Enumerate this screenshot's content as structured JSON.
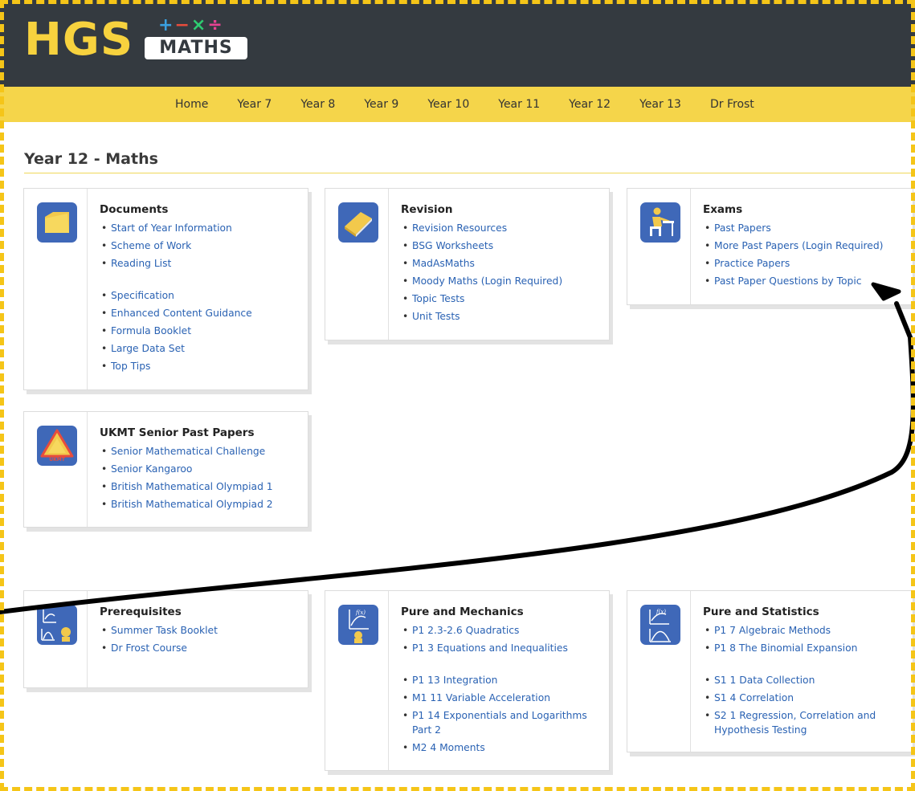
{
  "logo": {
    "main": "HGS",
    "sub": "MATHS",
    "operators": [
      "+",
      "−",
      "×",
      "÷"
    ]
  },
  "nav": [
    "Home",
    "Year 7",
    "Year 8",
    "Year 9",
    "Year 10",
    "Year 11",
    "Year 12",
    "Year 13",
    "Dr Frost"
  ],
  "page_title": "Year 12 - Maths",
  "cards": {
    "documents": {
      "title": "Documents",
      "links": [
        "Start of Year Information",
        "Scheme of Work",
        "Reading List"
      ],
      "links2": [
        "Specification",
        "Enhanced Content Guidance",
        "Formula Booklet",
        "Large Data Set",
        "Top Tips"
      ]
    },
    "revision": {
      "title": "Revision",
      "links": [
        "Revision Resources",
        "BSG Worksheets",
        "MadAsMaths",
        "Moody Maths (Login Required)",
        "Topic Tests",
        "Unit Tests"
      ]
    },
    "exams": {
      "title": "Exams",
      "links": [
        "Past Papers",
        "More Past Papers (Login Required)",
        "Practice Papers",
        "Past Paper Questions by Topic"
      ]
    },
    "ukmt": {
      "title": "UKMT Senior Past Papers",
      "icon_text": "UKMT",
      "links": [
        "Senior Mathematical Challenge",
        "Senior Kangaroo",
        "British Mathematical Olympiad 1",
        "British Mathematical Olympiad 2"
      ]
    },
    "prerequisites": {
      "title": "Prerequisites",
      "links": [
        "Summer Task Booklet",
        "Dr Frost Course"
      ]
    },
    "pure_mechanics": {
      "title": "Pure and Mechanics",
      "links": [
        "P1 2.3-2.6 Quadratics",
        "P1 3 Equations and Inequalities"
      ],
      "links2": [
        "P1 13 Integration",
        "M1 11 Variable Acceleration",
        "P1 14 Exponentials and Logarithms Part 2",
        "M2 4 Moments"
      ]
    },
    "pure_statistics": {
      "title": "Pure and Statistics",
      "links": [
        "P1 7 Algebraic Methods",
        "P1 8 The Binomial Expansion"
      ],
      "links2": [
        "S1 1 Data Collection",
        "S1 4 Correlation",
        "S2 1 Regression, Correlation and Hypothesis Testing"
      ]
    }
  },
  "colors": {
    "header": "#343a40",
    "navbar": "#f5d54a",
    "logo_yellow": "#f7d23e",
    "icon_blue": "#3f68b8",
    "link": "#2a62b3"
  }
}
